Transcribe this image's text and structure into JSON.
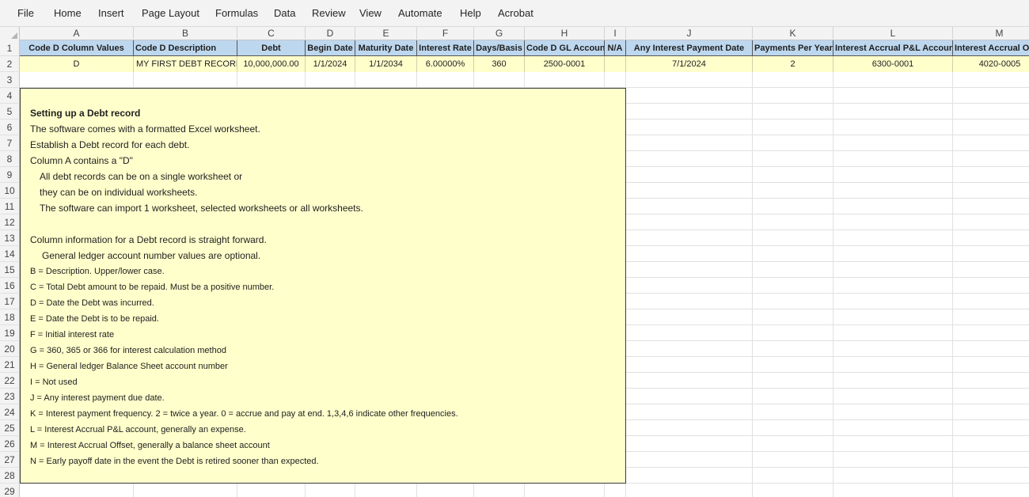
{
  "menu": [
    "File",
    "Home",
    "Insert",
    "Page Layout",
    "Formulas",
    "Data",
    "Review",
    "View",
    "Automate",
    "Help",
    "Acrobat"
  ],
  "columns": [
    "A",
    "B",
    "C",
    "D",
    "E",
    "F",
    "G",
    "H",
    "I",
    "J",
    "K",
    "L",
    "M"
  ],
  "row_numbers": [
    "1",
    "2",
    "3",
    "4",
    "5",
    "6",
    "7",
    "8",
    "9",
    "10",
    "11",
    "12",
    "13",
    "14",
    "15",
    "16",
    "17",
    "18",
    "19",
    "20",
    "21",
    "22",
    "23",
    "24",
    "25",
    "26",
    "27",
    "28",
    "29"
  ],
  "headers": {
    "a": "Code D Column Values",
    "b": "Code D Description",
    "c": "Debt",
    "d": "Begin Date",
    "e": "Maturity Date",
    "f": "Interest Rate",
    "g": "Days/Basis",
    "h": "Code D GL Account",
    "i": "N/A",
    "j": "Any Interest Payment Date",
    "k": "Payments Per Year",
    "l": "Interest Accrual P&L Account",
    "m": "Interest Accrual Of"
  },
  "record": {
    "a": "D",
    "b": "MY FIRST DEBT RECORD",
    "c": "10,000,000.00",
    "d": "1/1/2024",
    "e": "1/1/2034",
    "f": "6.00000%",
    "g": "360",
    "h": "2500-0001",
    "i": "",
    "j": "7/1/2024",
    "k": "2",
    "l": "6300-0001",
    "m": "4020-0005"
  },
  "notes": {
    "r5": "Setting up a Debt record",
    "r6": "The software comes with a formatted Excel worksheet.",
    "r7": "Establish a Debt record for each debt.",
    "r8": "Column A contains a \"D\"",
    "r9": "All debt records can be on a single worksheet or",
    "r10": "they can be on individual worksheets.",
    "r11": "The software can import 1 worksheet, selected worksheets or all worksheets.",
    "r13": "Column information for a Debt record is straight forward.",
    "r14": "General ledger account number values are optional.",
    "r15": "B = Description.  Upper/lower case.",
    "r16": "C = Total Debt amount to be repaid.  Must be a positive number.",
    "r17": "D = Date the Debt was incurred.",
    "r18": "E = Date the Debt is to be repaid.",
    "r19": "F = Initial interest rate",
    "r20": "G = 360, 365 or 366 for interest calculation method",
    "r21": "H = General ledger Balance Sheet account number",
    "r22": "I = Not used",
    "r23": "J = Any interest payment due date.",
    "r24": "K = Interest payment frequency.  2 = twice a year. 0 = accrue and pay at end.  1,3,4,6 indicate other frequencies.",
    "r25": "L = Interest Accrual P&L account, generally an expense.",
    "r26": "M = Interest Accrual Offset, generally a balance sheet account",
    "r27": "N = Early payoff date in the event the Debt is retired sooner than expected."
  },
  "colors": {
    "header_fill": "#bdd7ee",
    "record_fill": "#ffffcc",
    "notes_fill": "#ffffcc"
  }
}
